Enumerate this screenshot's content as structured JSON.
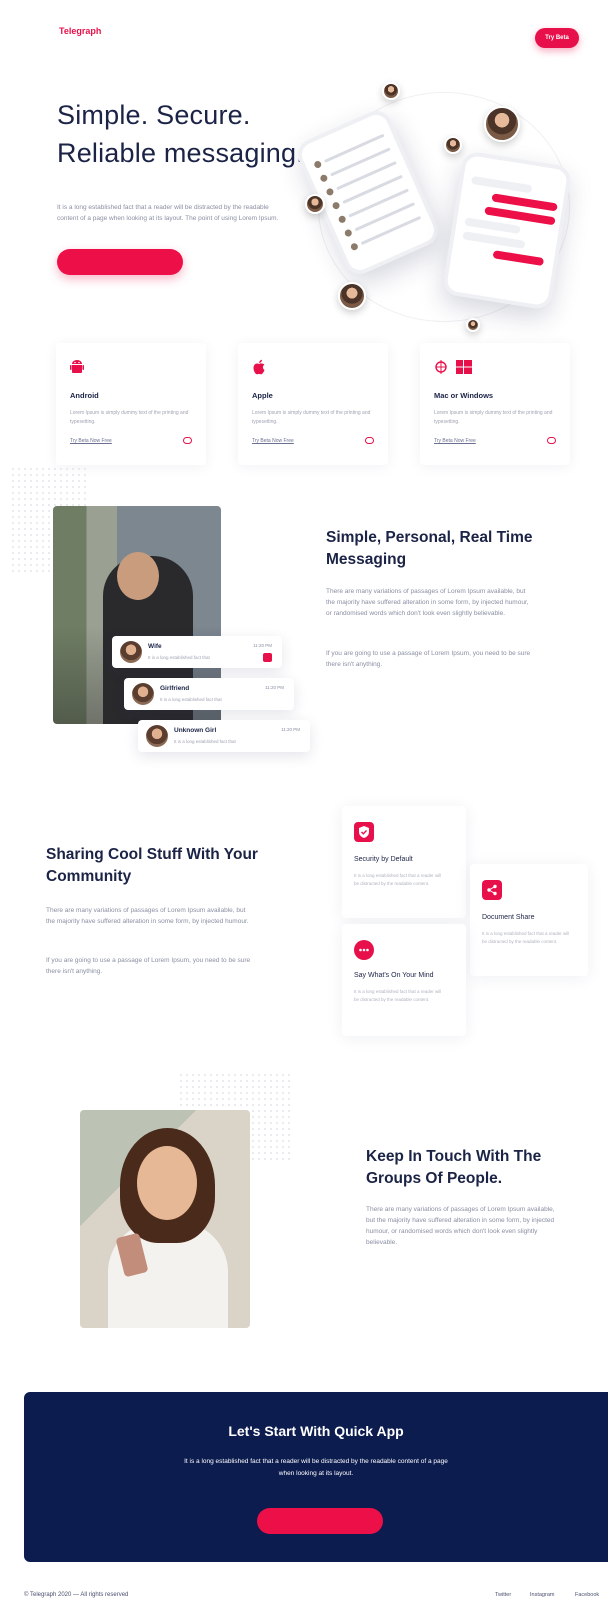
{
  "header": {
    "logo": "Telegraph",
    "try_button": "Try Beta"
  },
  "hero": {
    "title_line1": "Simple. Secure.",
    "title_line2": "Reliable messaging.",
    "description": "It is a long established fact that a reader will be distracted by the readable content of a page when looking at its layout. The point of using Lorem Ipsum."
  },
  "platforms": [
    {
      "name": "Android",
      "icon": "android-icon",
      "description": "Lorem Ipsum is simply dummy text of the printing and typesetting.",
      "link": "Try Beta Now Free"
    },
    {
      "name": "Apple",
      "icon": "apple-icon",
      "description": "Lorem Ipsum is simply dummy text of the printing and typesetting.",
      "link": "Try Beta Now Free"
    },
    {
      "name": "Mac or Windows",
      "icon": "windows-icon",
      "description": "Lorem Ipsum is simply dummy text of the printing and typesetting.",
      "link": "Try Beta Now Free"
    }
  ],
  "messaging": {
    "title_line1": "Simple, Personal, Real Time",
    "title_line2": "Messaging",
    "body1": "There are many variations of passages of Lorem Ipsum available, but the majority have suffered alteration in some form, by injected humour, or randomised words which don't look even slightly believable.",
    "body2": "If you are going to use a passage of Lorem Ipsum, you need to be sure there isn't anything.",
    "chats": [
      {
        "name": "Wife",
        "message": "It is a long established fact that",
        "time": "11:20 PM"
      },
      {
        "name": "Girlfriend",
        "message": "It is a long established fact that",
        "time": "11:20 PM"
      },
      {
        "name": "Unknown Girl",
        "message": "It is a long established fact that",
        "time": "11:20 PM"
      }
    ]
  },
  "sharing": {
    "title_line1": "Sharing Cool Stuff With Your",
    "title_line2": "Community",
    "body1": "There are many variations of passages of Lorem Ipsum available, but the majority have suffered alteration in some form, by injected humour.",
    "body2": "If you are going to use a passage of Lorem Ipsum, you need to be sure there isn't anything.",
    "features": [
      {
        "title": "Security by Default",
        "icon": "shield-check-icon",
        "description": "It is a long established fact that a reader will be distracted by the readable content."
      },
      {
        "title": "Document Share",
        "icon": "share-icon",
        "description": "It is a long established fact that a reader will be distracted by the readable content."
      },
      {
        "title": "Say What's On Your Mind",
        "icon": "chat-bubble-icon",
        "description": "It is a long established fact that a reader will be distracted by the readable content."
      }
    ]
  },
  "groups": {
    "title_line1": "Keep In Touch With The",
    "title_line2": "Groups Of People.",
    "body": "There are many variations of passages of Lorem Ipsum available, but the majority have suffered alteration in some form, by injected humour, or randomised words which don't look even slightly believable."
  },
  "cta": {
    "title": "Let's Start With Quick App",
    "description": "It is a long established fact that a reader will be distracted by the readable content of a page when looking at its layout."
  },
  "footer": {
    "copyright": "© Telegraph 2020 — All rights reserved",
    "links": [
      "Twitter",
      "Instagram",
      "Facebook"
    ]
  },
  "colors": {
    "accent": "#e8104a",
    "navy": "#0d1c4f",
    "heading": "#1b2346"
  }
}
